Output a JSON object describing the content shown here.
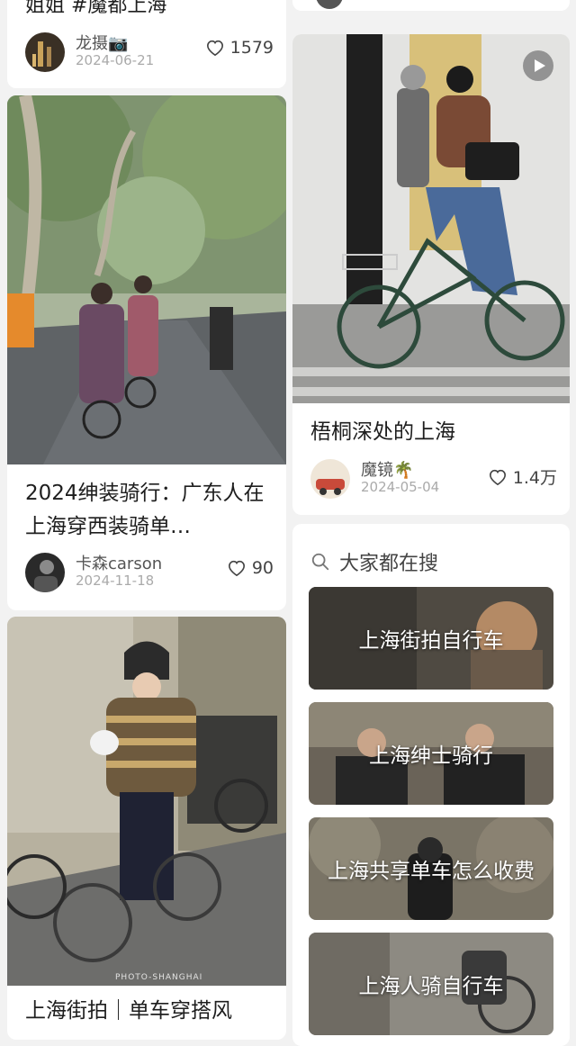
{
  "left": {
    "card1": {
      "title_fragment": "姐姐 #魔都上海",
      "author": "龙摄📷",
      "date": "2024-06-21",
      "likes": "1579"
    },
    "card2": {
      "title": "2024绅装骑行：广东人在上海穿西装骑单…",
      "author": "卡森carson",
      "date": "2024-11-18",
      "likes": "90"
    },
    "card3": {
      "watermark": "PHOTO-SHANGHAI",
      "title": "上海街拍｜单车穿搭风"
    }
  },
  "right": {
    "card1": {
      "title": "梧桐深处的上海",
      "author": "魔镜🌴",
      "date": "2024-05-04",
      "likes": "1.4万"
    },
    "search": {
      "heading": "大家都在搜",
      "items": [
        {
          "label": "上海街拍自行车"
        },
        {
          "label": "上海绅士骑行"
        },
        {
          "label": "上海共享单车怎么收费"
        },
        {
          "label": "上海人骑自行车"
        }
      ]
    }
  },
  "colors": {
    "background": "#f2f2f2",
    "card": "#ffffff",
    "text": "#1e1e1e",
    "meta": "#aaaaaa"
  }
}
